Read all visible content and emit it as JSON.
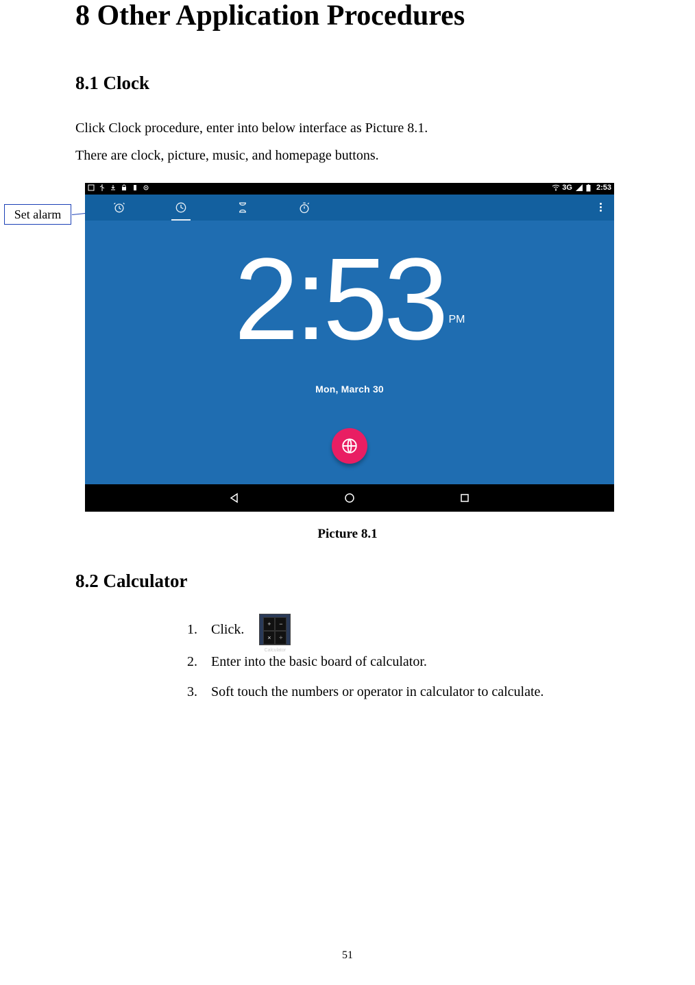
{
  "title": "8 Other Application Procedures",
  "section_clock": {
    "heading": "8.1 Clock",
    "p1": "Click Clock procedure, enter into below interface as Picture 8.1.",
    "p2": "There are clock, picture, music, and homepage buttons."
  },
  "callout_label": "Set alarm",
  "screenshot": {
    "status_time": "2:53",
    "network_label": "3G",
    "big_time": "2:53",
    "ampm": "PM",
    "date": "Mon, March 30"
  },
  "caption": "Picture 8.1",
  "section_calc": {
    "heading": "8.2 Calculator",
    "items": [
      {
        "num": "1.",
        "text": "Click."
      },
      {
        "num": "2.",
        "text": "Enter into the basic board of calculator."
      },
      {
        "num": "3.",
        "text": "Soft touch the numbers or operator in calculator to calculate."
      }
    ],
    "icon_label": "Calculator",
    "icon_symbols": [
      "+",
      "−",
      "×",
      "÷"
    ]
  },
  "page_number": "51"
}
